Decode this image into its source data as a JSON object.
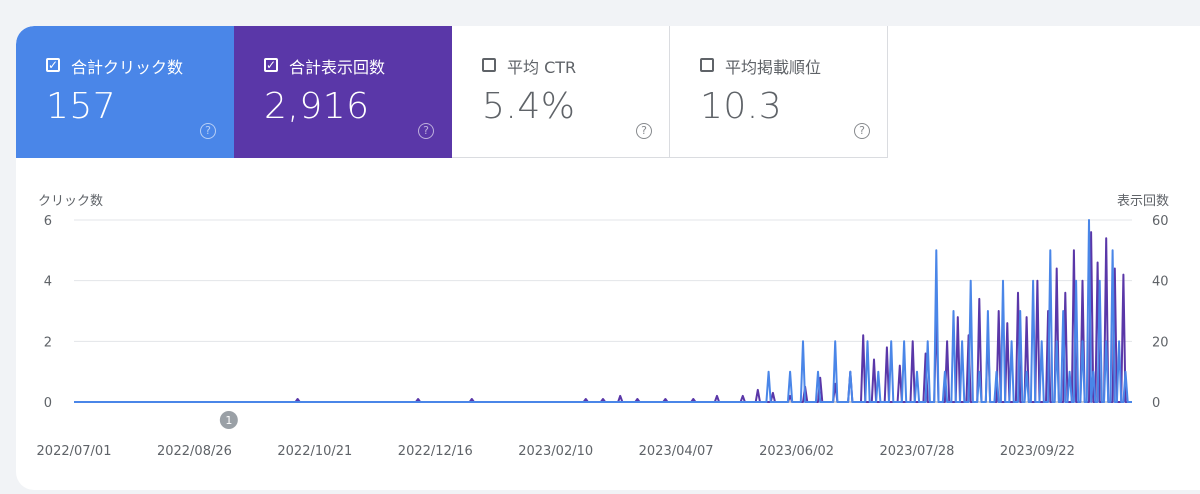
{
  "metrics": [
    {
      "label": "合計クリック数",
      "value": "157",
      "checked": true,
      "help": "?"
    },
    {
      "label": "合計表示回数",
      "value": "2,916",
      "checked": true,
      "help": "?"
    },
    {
      "label": "平均 CTR",
      "value": "5.4%",
      "checked": false,
      "help": "?"
    },
    {
      "label": "平均掲載順位",
      "value": "10.3",
      "checked": false,
      "help": "?"
    }
  ],
  "chart_data": {
    "type": "line",
    "left_axis_label": "クリック数",
    "right_axis_label": "表示回数",
    "left_ticks": [
      "6",
      "4",
      "2",
      "0"
    ],
    "right_ticks": [
      "60",
      "40",
      "20",
      "0"
    ],
    "ylim_left": [
      0,
      6
    ],
    "ylim_right": [
      0,
      60
    ],
    "x_ticks": [
      "2022/07/01",
      "2022/08/26",
      "2022/10/21",
      "2022/12/16",
      "2023/02/10",
      "2023/04/07",
      "2023/06/02",
      "2023/07/28",
      "2023/09/22"
    ],
    "x_range": [
      "2022/07/01",
      "2023/11/05"
    ],
    "annotation": "1",
    "colors": {
      "clicks": "#4a86e8",
      "impressions": "#5a37a8"
    },
    "series": [
      {
        "name": "クリック数",
        "axis": "left",
        "points": [
          [
            "2023/05/20",
            1
          ],
          [
            "2023/05/30",
            1
          ],
          [
            "2023/06/05",
            2
          ],
          [
            "2023/06/12",
            1
          ],
          [
            "2023/06/20",
            2
          ],
          [
            "2023/06/27",
            1
          ],
          [
            "2023/07/05",
            2
          ],
          [
            "2023/07/10",
            1
          ],
          [
            "2023/07/16",
            2
          ],
          [
            "2023/07/22",
            2
          ],
          [
            "2023/07/28",
            1
          ],
          [
            "2023/08/02",
            2
          ],
          [
            "2023/08/06",
            5
          ],
          [
            "2023/08/10",
            1
          ],
          [
            "2023/08/14",
            3
          ],
          [
            "2023/08/18",
            2
          ],
          [
            "2023/08/22",
            4
          ],
          [
            "2023/08/26",
            1
          ],
          [
            "2023/08/30",
            3
          ],
          [
            "2023/09/03",
            1
          ],
          [
            "2023/09/06",
            4
          ],
          [
            "2023/09/10",
            2
          ],
          [
            "2023/09/14",
            3
          ],
          [
            "2023/09/17",
            1
          ],
          [
            "2023/09/20",
            4
          ],
          [
            "2023/09/24",
            2
          ],
          [
            "2023/09/28",
            5
          ],
          [
            "2023/10/01",
            2
          ],
          [
            "2023/10/04",
            3
          ],
          [
            "2023/10/07",
            1
          ],
          [
            "2023/10/10",
            4
          ],
          [
            "2023/10/13",
            2
          ],
          [
            "2023/10/16",
            6
          ],
          [
            "2023/10/18",
            1
          ],
          [
            "2023/10/21",
            4
          ],
          [
            "2023/10/24",
            2
          ],
          [
            "2023/10/27",
            5
          ],
          [
            "2023/10/30",
            2
          ],
          [
            "2023/11/02",
            1
          ]
        ]
      },
      {
        "name": "表示回数",
        "axis": "right",
        "points": [
          [
            "2022/10/13",
            1
          ],
          [
            "2022/12/08",
            1
          ],
          [
            "2023/01/02",
            1
          ],
          [
            "2023/02/24",
            1
          ],
          [
            "2023/03/04",
            1
          ],
          [
            "2023/03/12",
            2
          ],
          [
            "2023/03/20",
            1
          ],
          [
            "2023/04/02",
            1
          ],
          [
            "2023/04/15",
            1
          ],
          [
            "2023/04/26",
            2
          ],
          [
            "2023/05/08",
            2
          ],
          [
            "2023/05/15",
            4
          ],
          [
            "2023/05/22",
            3
          ],
          [
            "2023/05/30",
            2
          ],
          [
            "2023/06/06",
            5
          ],
          [
            "2023/06/13",
            8
          ],
          [
            "2023/06/20",
            6
          ],
          [
            "2023/06/27",
            10
          ],
          [
            "2023/07/03",
            22
          ],
          [
            "2023/07/08",
            14
          ],
          [
            "2023/07/14",
            18
          ],
          [
            "2023/07/20",
            12
          ],
          [
            "2023/07/26",
            20
          ],
          [
            "2023/08/01",
            16
          ],
          [
            "2023/08/06",
            30
          ],
          [
            "2023/08/11",
            20
          ],
          [
            "2023/08/16",
            28
          ],
          [
            "2023/08/21",
            22
          ],
          [
            "2023/08/26",
            34
          ],
          [
            "2023/08/30",
            24
          ],
          [
            "2023/09/04",
            30
          ],
          [
            "2023/09/08",
            26
          ],
          [
            "2023/09/13",
            36
          ],
          [
            "2023/09/17",
            28
          ],
          [
            "2023/09/22",
            40
          ],
          [
            "2023/09/27",
            30
          ],
          [
            "2023/10/01",
            44
          ],
          [
            "2023/10/05",
            36
          ],
          [
            "2023/10/09",
            50
          ],
          [
            "2023/10/13",
            40
          ],
          [
            "2023/10/17",
            56
          ],
          [
            "2023/10/20",
            46
          ],
          [
            "2023/10/24",
            54
          ],
          [
            "2023/10/28",
            44
          ],
          [
            "2023/11/01",
            42
          ]
        ]
      }
    ]
  }
}
